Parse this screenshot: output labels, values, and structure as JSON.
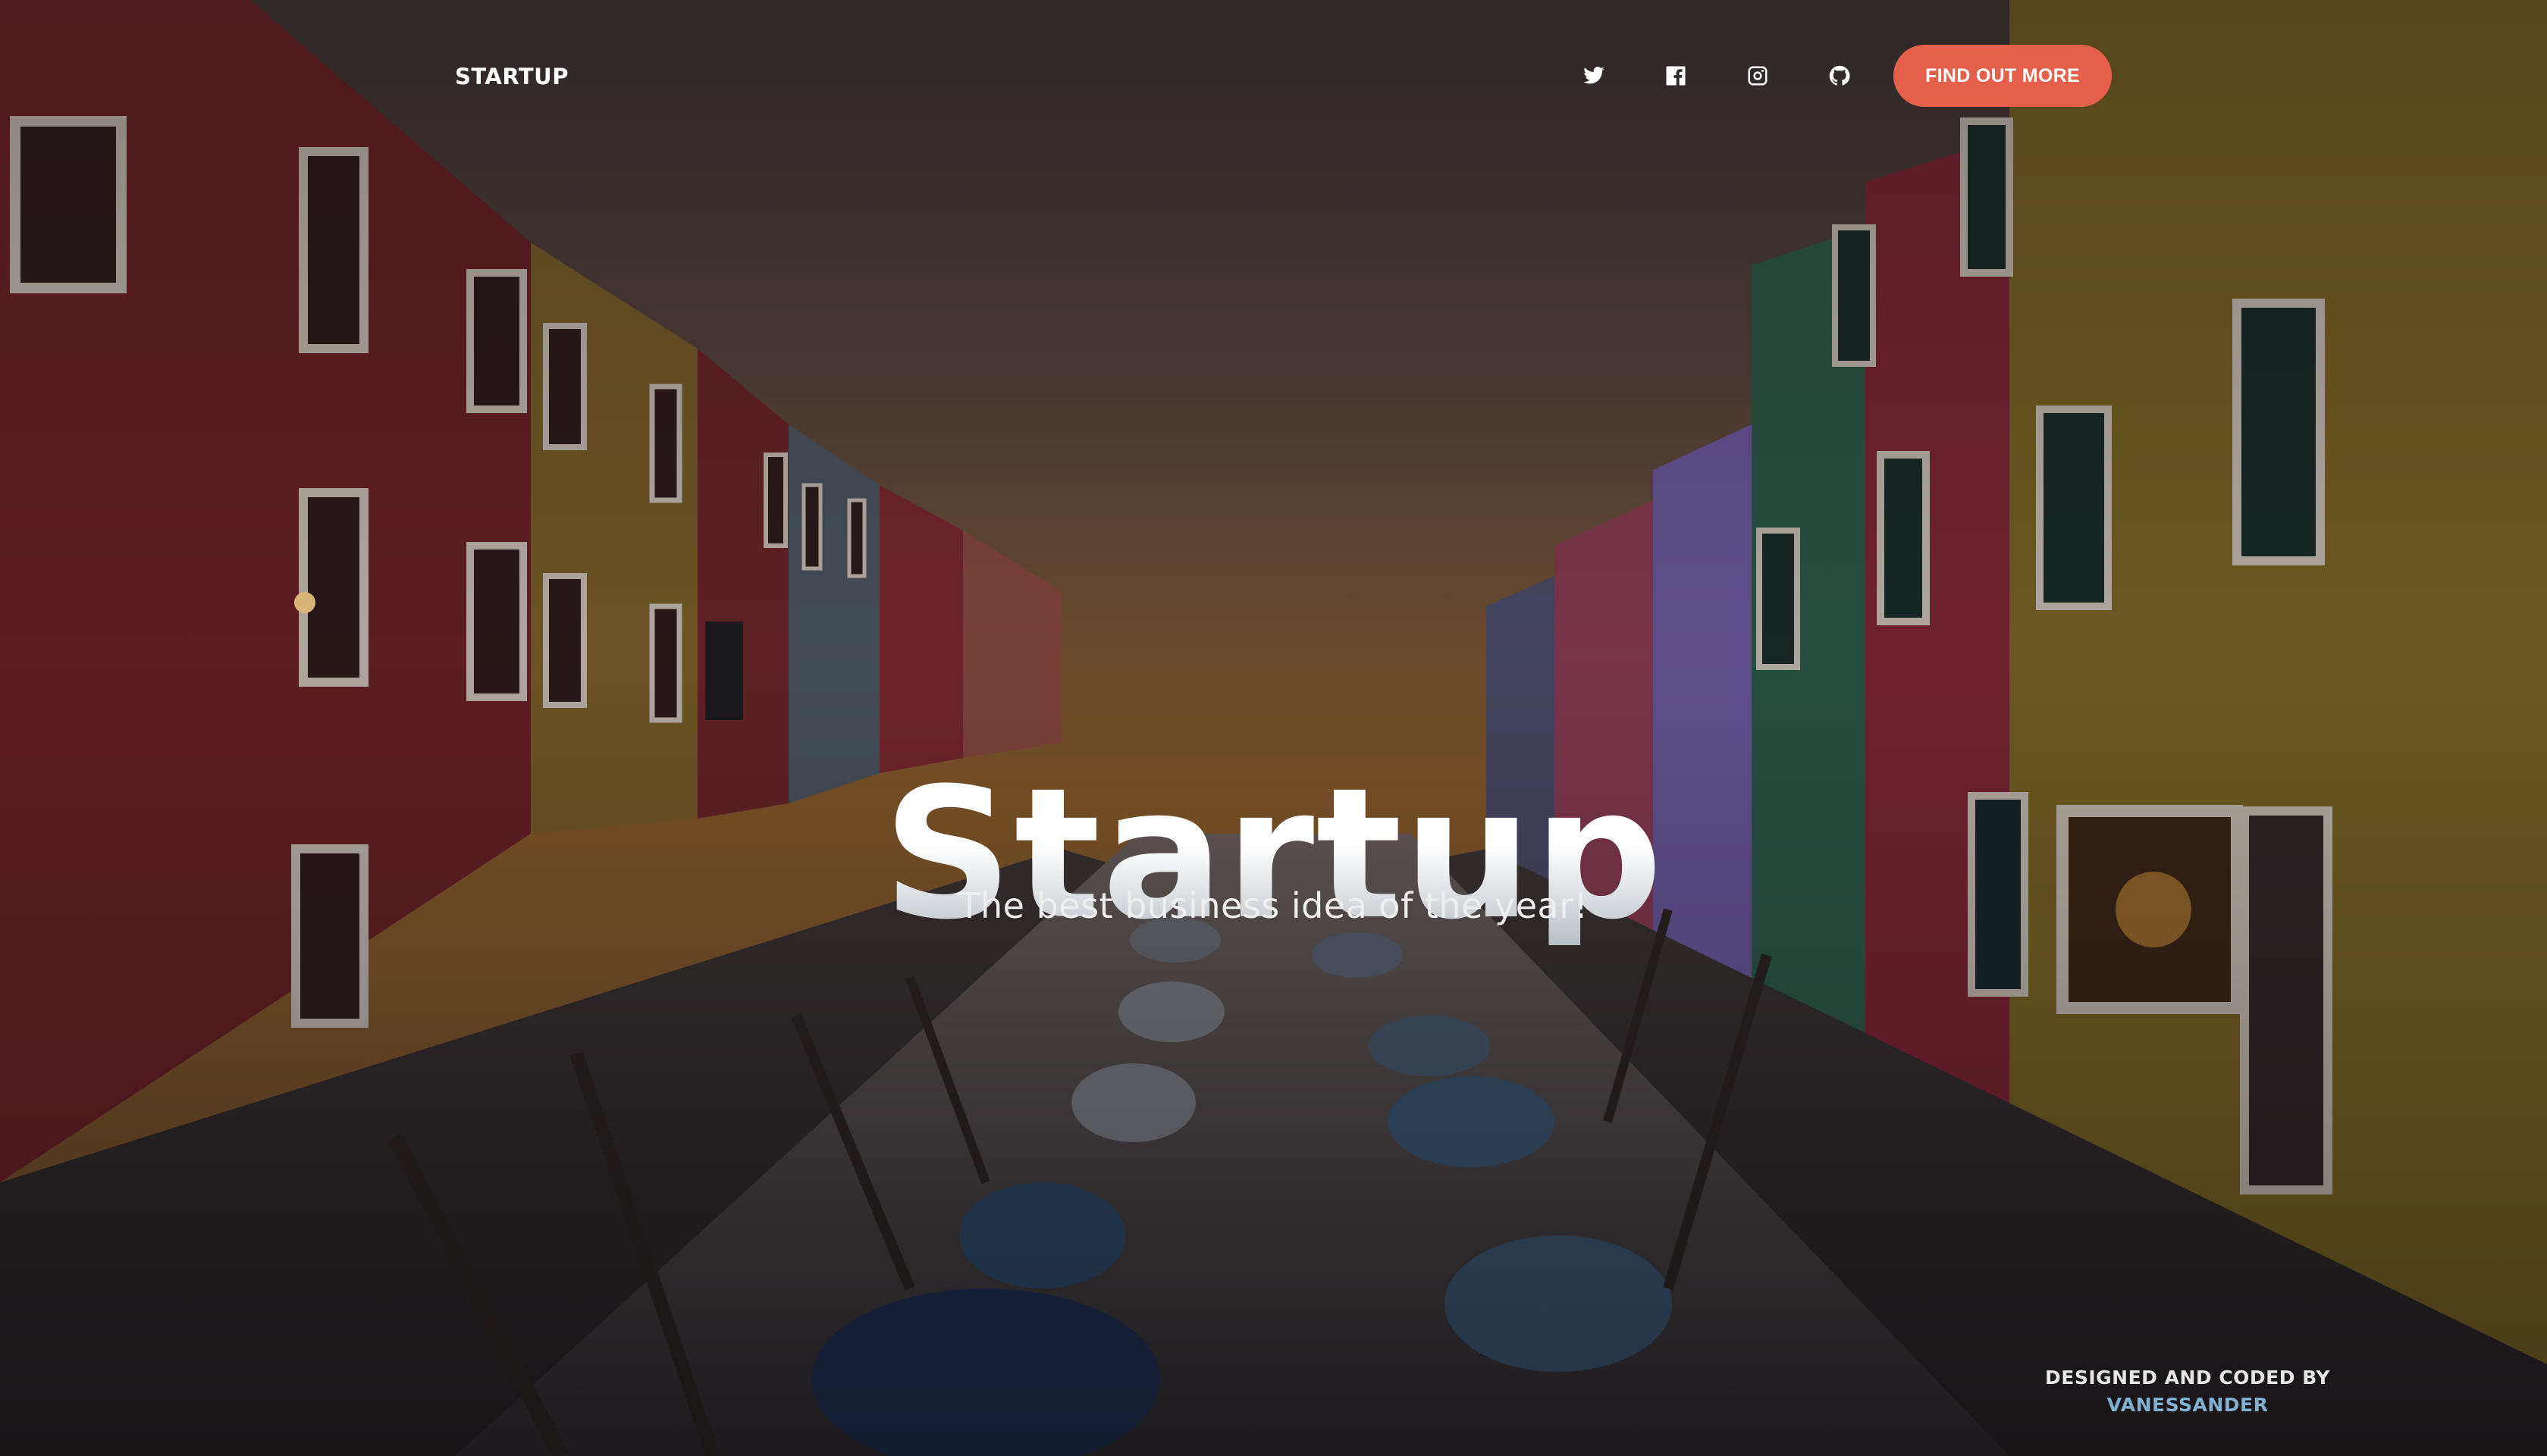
{
  "nav": {
    "brand": "STARTUP",
    "social": [
      {
        "icon": "twitter-icon"
      },
      {
        "icon": "facebook-icon"
      },
      {
        "icon": "instagram-icon"
      },
      {
        "icon": "github-icon"
      }
    ],
    "cta_label": "FIND OUT MORE"
  },
  "hero": {
    "title": "Startup",
    "subtitle": "The best business idea of the year!"
  },
  "footer": {
    "credit_label": "DESIGNED AND CODED BY",
    "credit_author": "VANESSANDER"
  },
  "colors": {
    "accent": "#e4604a",
    "link": "#7fb0cf",
    "text": "#ffffff"
  },
  "background": {
    "subject": "canal-street-photo"
  }
}
